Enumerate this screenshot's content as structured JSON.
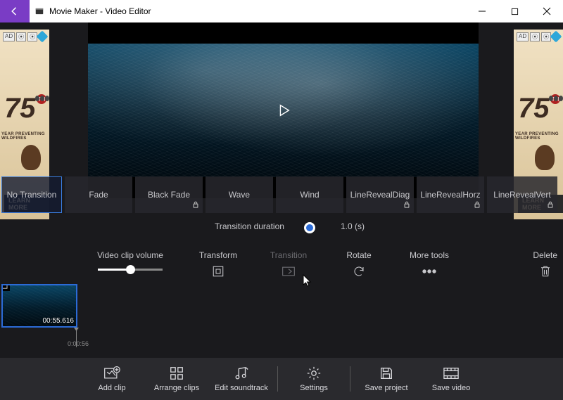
{
  "titlebar": {
    "title": "Movie Maker - Video Editor"
  },
  "ads": {
    "badge1": "AD",
    "number": "75",
    "th": "TH",
    "tagline": "YEAR PREVENTING WILDFIRES",
    "cta": "LEARN MORE"
  },
  "transitions": {
    "items": [
      {
        "label": "No Transition",
        "locked": false,
        "selected": true
      },
      {
        "label": "Fade",
        "locked": false,
        "selected": false
      },
      {
        "label": "Black Fade",
        "locked": true,
        "selected": false
      },
      {
        "label": "Wave",
        "locked": false,
        "selected": false
      },
      {
        "label": "Wind",
        "locked": false,
        "selected": false
      },
      {
        "label": "LineRevealDiag",
        "locked": true,
        "selected": false
      },
      {
        "label": "LineRevealHorz",
        "locked": true,
        "selected": false
      },
      {
        "label": "LineRevealVert",
        "locked": true,
        "selected": false
      }
    ]
  },
  "duration": {
    "label": "Transition duration",
    "value": "1.0 (s)"
  },
  "tools": {
    "volume_label": "Video clip volume",
    "transform": "Transform",
    "transition": "Transition",
    "rotate": "Rotate",
    "moretools": "More tools",
    "delete": "Delete"
  },
  "timeline": {
    "clip_time": "00:55.616",
    "playhead_time": "0:00:56"
  },
  "bottombar": {
    "addclip": "Add clip",
    "arrange": "Arrange clips",
    "soundtrack": "Edit soundtrack",
    "settings": "Settings",
    "saveproject": "Save project",
    "savevideo": "Save video"
  }
}
